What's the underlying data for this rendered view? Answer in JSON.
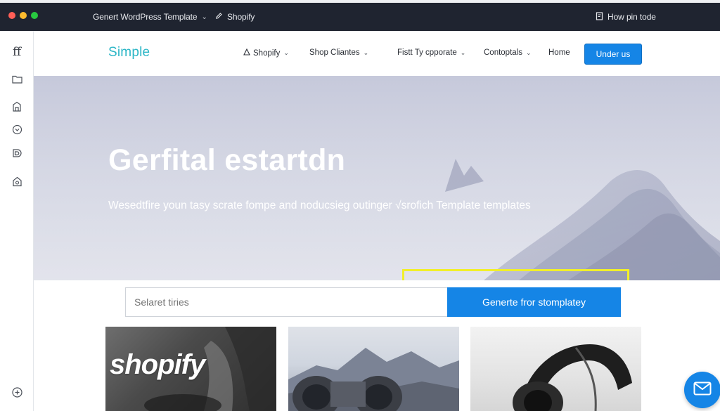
{
  "window": {
    "tabs": [
      {
        "label": "Genert WordPress Template",
        "has_dropdown": true
      },
      {
        "label": "Shopify",
        "icon": "pencil-icon"
      }
    ],
    "right_action": {
      "label": "How pin tode",
      "icon": "note-icon"
    }
  },
  "rail": {
    "logo": "ff",
    "icons": [
      "folder-icon",
      "building-icon",
      "chevron-circle-icon",
      "layers-icon",
      "shield-icon"
    ],
    "bottom_icon": "plus-circle-icon"
  },
  "site_nav": {
    "brand": "Simple",
    "links": [
      {
        "label": "Shopify",
        "icon": "triangle-icon",
        "has_dropdown": true
      },
      {
        "label": "Shop Cliantes",
        "has_dropdown": true
      },
      {
        "label": "Fistt Ty cpporate",
        "has_dropdown": true
      },
      {
        "label": "Contoptals",
        "has_dropdown": true
      },
      {
        "label": "Home",
        "has_dropdown": false
      }
    ],
    "cta_label": "Under us"
  },
  "hero": {
    "title": "Gerfital estartdn",
    "subtitle": "Wesedtfire youn tasy scrate fompe and noducsieg outinger √srofich Template templates"
  },
  "search": {
    "placeholder": "Selaret tiries",
    "button_label": "Generte fror stomplatey"
  },
  "cards": [
    {
      "text": "shopify"
    },
    {
      "text": ""
    },
    {
      "text": ""
    }
  ],
  "colors": {
    "accent": "#1585e6",
    "brand": "#2bb6c6",
    "titlebar": "#1f2430",
    "highlight": "#f1ef2a"
  },
  "fab_icon": "mail-icon"
}
